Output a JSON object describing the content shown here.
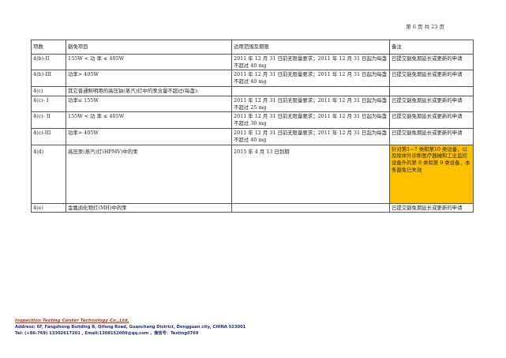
{
  "page_number": "第 6 页 共 23 页",
  "table": {
    "headers": [
      "项数",
      "豁免项目",
      "适用范围及期限",
      "备注"
    ],
    "rows": [
      {
        "id": "4(b)-II",
        "item": "155W < 功 率 ≤ 405W",
        "scope": "2011 年 12 月 31 日前无限量要求；2011 年 12 月 31 日起为每盏不超过 40 mg",
        "note": "已提交豁免期延长或更新的申请",
        "highlight": false
      },
      {
        "id": "4(b)-III",
        "item": "功率> 405W",
        "scope": "2011 年 12 月 31 日前无限量要求；2011 年 12 月 31 日起为每盏不超过 40 mg",
        "note": "已提交豁免期延长或更新的申请",
        "highlight": false
      },
      {
        "id": "4(c)",
        "item": "其它普通照明用的高压钠(蒸汽)灯中的汞含量不超过(每盏):",
        "scope": "",
        "note": "",
        "highlight": false
      },
      {
        "id": "4(c)- I",
        "item": "功率≤ 155W",
        "scope": "2011 年 12 月 31 日前无限量要求；2011 年 12 月 31 日起为每盏不超过 25 mg",
        "note": "已提交豁免期延长或更新的申请",
        "highlight": false
      },
      {
        "id": "4(c)- II",
        "item": "155W < 功 率 ≤ 405W",
        "scope": "2011 年 12 月 31 日前无限量要求；2011 年 12 月 31 日起为每盏不超过 30 mg",
        "note": "已提交豁免期延长或更新的申请",
        "highlight": false
      },
      {
        "id": "4(c)-III",
        "item": "功率> 405W",
        "scope": "2011 年 12 月 31 日前无限量要求；2011 年 12 月 31 日起为每盏不超过 40 mg",
        "note": "已提交豁免期延长或更新的申请",
        "highlight": false
      },
      {
        "id": "4(d)",
        "item": "高压汞(蒸汽)灯(HPMV)中的汞",
        "scope": "2015 年 4 月 13 日到期",
        "note": "针对第1~7 类和第10 类设备，以及除体外诊断医疗器械和工业监控设备外的第 8 类和第 9 类设备，本条豁免已失效",
        "highlight": true
      },
      {
        "id": "4(e)",
        "item": "金属卤化物灯(MH)中的汞",
        "scope": "",
        "note": "已提交豁免期延长或更新的申请",
        "highlight": false
      }
    ]
  },
  "footer": {
    "company": "Inspection Testing Center Technology Co.,Ltd.",
    "address": "Address: 6F, Fangzhong Building B, Qifeng Road, Guancheng District, Dongguan city, CHINA 523001",
    "contact": "Tel: (+86-769) 13302617201 , Email:1308152009@qq.com ，微信号：Testing0769"
  }
}
